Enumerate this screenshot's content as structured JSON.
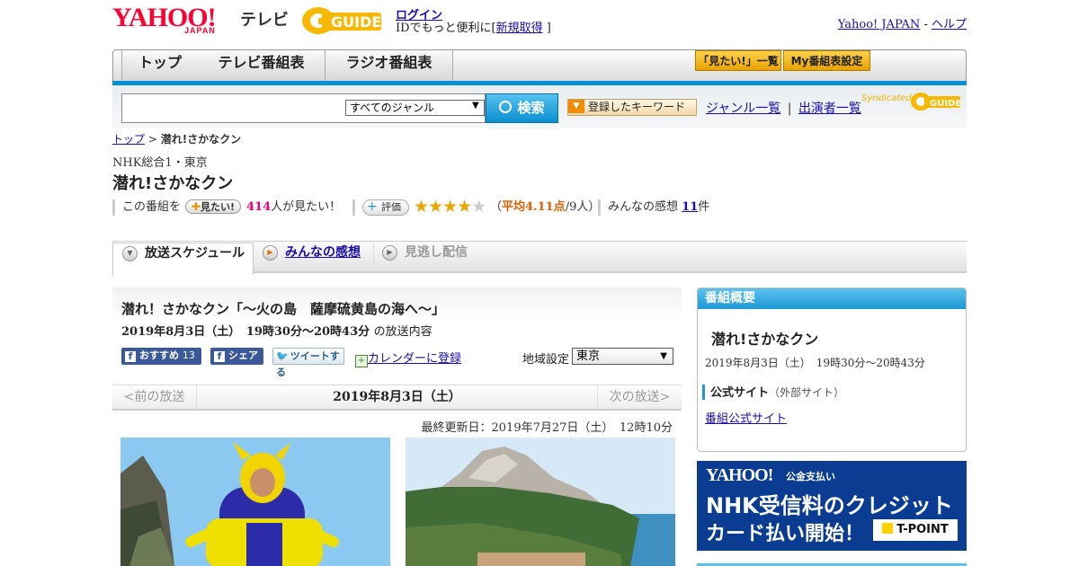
{
  "header": {
    "logo_yahoo": "YAHOO!",
    "logo_japan": "JAPAN",
    "logo_tv": "テレビ",
    "logo_guide": "GUIDE",
    "login": "ログイン",
    "id_prefix": "IDでもっと便利に[",
    "signup": "新規取得",
    "id_suffix": "]",
    "yahoo_japan_link": "Yahoo! JAPAN",
    "sep": " - ",
    "help_link": "ヘルプ"
  },
  "nav": {
    "tabs": [
      "トップ",
      "テレビ番組表",
      "ラジオ番組表"
    ],
    "mitai_list": "「見たい!」一覧",
    "my_schedule": "My番組表設定"
  },
  "search": {
    "genre_selected": "すべてのジャンル",
    "button": "検索",
    "keyword_button": "登録したキーワード",
    "genre_list": "ジャンル一覧",
    "divider": "|",
    "performer_list": "出演者一覧",
    "syndicated": "Syndicated"
  },
  "breadcrumb": {
    "top": "トップ",
    "sep": " > ",
    "current": "潜れ!さかなクン"
  },
  "program": {
    "station": "NHK総合1・東京",
    "title": "潜れ!さかなクン",
    "this_program": "この番組を",
    "mitai_button": "見たい!",
    "mitai_count": "414",
    "mitai_suffix": "人が見たい！",
    "hyoka": "評価",
    "stars": "★★★★",
    "star_empty": "★",
    "rating_open": "（",
    "rating": "平均4.11点",
    "rating_count": "/9人）",
    "impressions_label": "みんなの感想",
    "impressions_count": "11",
    "impressions_suffix": "件"
  },
  "tabs": {
    "schedule": "放送スケジュール",
    "impressions": "みんなの感想",
    "missed": "見逃し配信"
  },
  "episode": {
    "title": "潜れ！さかなクン「～火の島　薩摩硫黄島の海へ～」",
    "time": "2019年8月3日（土）　19時30分～20時43分",
    "time_suffix": "の放送内容",
    "recommend": "おすすめ",
    "recommend_count": "13",
    "share": "シェア",
    "tweet": "ツイートする",
    "calendar": "カレンダーに登録",
    "region_label": "地域設定",
    "region_value": "東京",
    "prev": "<前の放送",
    "date": "2019年8月3日（土）",
    "next": "次の放送>",
    "updated": "最終更新日：2019年7月27日（土）　12時10分"
  },
  "sidebar": {
    "header": "番組概要",
    "title": "潜れ!さかなクン",
    "time": "2019年8月3日（土）　19時30分～20時43分",
    "official_label": "公式サイト",
    "official_note": "（外部サイト）",
    "official_link": "番組公式サイト"
  },
  "banner": {
    "brand": "YAHOO!",
    "brand_sub": "公金支払い",
    "line1": "NHK受信料のクレジット",
    "line2": "カード払い開始！",
    "tpoint": "T-POINT"
  },
  "colors": {
    "accent_blue": "#0091d7",
    "yahoo_red": "#ff0033",
    "pink_count": "#e4007f",
    "rating_orange": "#e06000",
    "star": "#e8a800"
  }
}
